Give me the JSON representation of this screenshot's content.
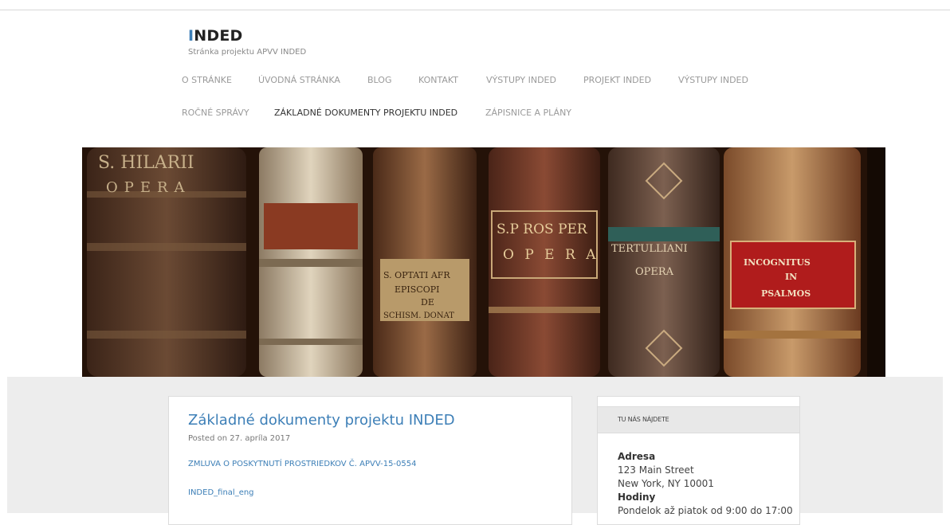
{
  "site": {
    "title_first": "I",
    "title_rest": "NDED",
    "tagline": "Stránka projektu APVV INDED"
  },
  "nav": [
    "O STRÁNKE",
    "ÚVODNÁ STRÁNKA",
    "BLOG",
    "KONTAKT",
    "VÝSTUPY INDED",
    "PROJEKT INDED",
    "VÝSTUPY INDED",
    "ROČNÉ SPRÁVY",
    "ZÁKLADNÉ DOKUMENTY PROJEKTU INDED",
    "ZÁPISNICE A PLÁNY"
  ],
  "hero": {
    "spine_labels": [
      "S. HILARII",
      "OPERA",
      "S.P ROS PER",
      "O P E R A",
      "TERTULLIANI",
      "OPERA",
      "S. OPTATI AFR",
      "EPISCOPI",
      "DE",
      "SCHISM. DONAT",
      "INCOGNITUS",
      "IN",
      "PSALMOS"
    ]
  },
  "post": {
    "title": "Základné dokumenty projektu INDED",
    "posted_label": "Posted on",
    "posted_date": "27. apríla 2017",
    "link1": "ZMLUVA O POSKYTNUTÍ PROSTRIEDKOV Č. APVV-15-0554",
    "link2": "INDED_final_eng"
  },
  "widget": {
    "heading": "TU NÁS NÁJDETE",
    "address_label": "Adresa",
    "address_line1": "123 Main Street",
    "address_line2": "New York, NY 10001",
    "hours_label": "Hodiny",
    "hours_text": "Pondelok až piatok od 9:00 do 17:00"
  },
  "colors": {
    "accent": "#3d7fb7",
    "band": "#ededed"
  }
}
